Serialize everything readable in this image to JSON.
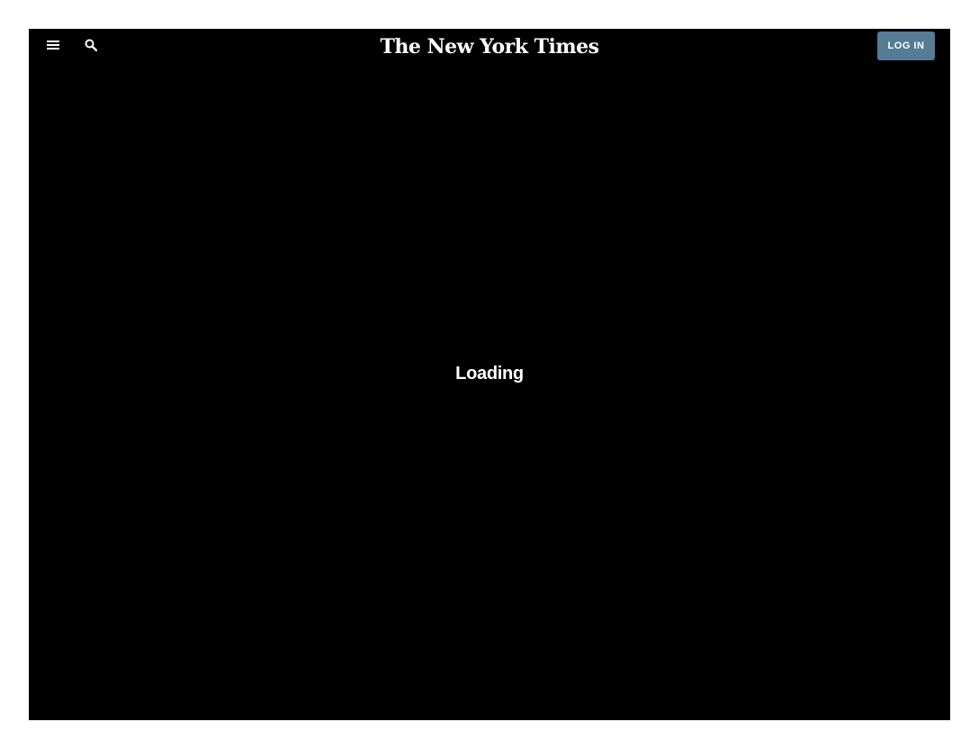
{
  "header": {
    "menu_icon": "hamburger-menu-icon",
    "search_icon": "search-icon",
    "logo_text": "The New York Times",
    "login_label": "LOG IN"
  },
  "main": {
    "status_text": "Loading"
  },
  "colors": {
    "background": "#000000",
    "page_background": "#ffffff",
    "login_button": "#567b95",
    "text": "#ffffff"
  }
}
